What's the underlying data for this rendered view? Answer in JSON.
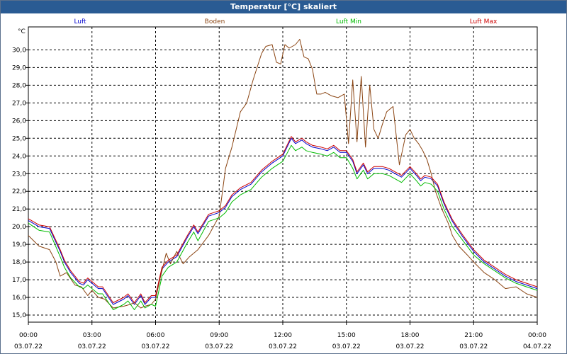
{
  "window": {
    "title": "Temperatur [°C] skaliert"
  },
  "chart_data": {
    "type": "line",
    "title": "Temperatur [°C] skaliert",
    "ylabel": "°C",
    "ylim": [
      14.6,
      31.3
    ],
    "xlim": [
      0,
      24
    ],
    "grid": true,
    "legend_position": "top",
    "y_ticks": [
      "15,0",
      "16,0",
      "17,0",
      "18,0",
      "19,0",
      "20,0",
      "21,0",
      "22,0",
      "23,0",
      "24,0",
      "25,0",
      "26,0",
      "27,0",
      "28,0",
      "29,0",
      "30,0"
    ],
    "x_ticks": [
      {
        "time": "00:00",
        "date": "03.07.22"
      },
      {
        "time": "03:00",
        "date": "03.07.22"
      },
      {
        "time": "06:00",
        "date": "03.07.22"
      },
      {
        "time": "09:00",
        "date": "03.07.22"
      },
      {
        "time": "12:00",
        "date": "03.07.22"
      },
      {
        "time": "15:00",
        "date": "03.07.22"
      },
      {
        "time": "18:00",
        "date": "03.07.22"
      },
      {
        "time": "21:00",
        "date": "03.07.22"
      },
      {
        "time": "00:00",
        "date": "04.07.22"
      }
    ],
    "series": [
      {
        "name": "Luft",
        "color": "#0000cc",
        "x": [
          0,
          0.5,
          1,
          1.5,
          1.7,
          2,
          2.4,
          2.6,
          2.8,
          3,
          3.3,
          3.5,
          4,
          4.5,
          4.7,
          5,
          5.3,
          5.5,
          5.8,
          6,
          6.3,
          6.6,
          7,
          7.5,
          7.8,
          8,
          8.5,
          9,
          9.3,
          9.6,
          10,
          10.5,
          11,
          11.3,
          11.5,
          12,
          12.4,
          12.6,
          12.9,
          13.1,
          13.4,
          13.8,
          14.1,
          14.4,
          14.7,
          15,
          15.3,
          15.5,
          15.8,
          16,
          16.3,
          16.7,
          17,
          17.3,
          17.6,
          18,
          18.3,
          18.5,
          18.7,
          19,
          19.3,
          19.6,
          20,
          20.5,
          21,
          21.5,
          22,
          22.5,
          23,
          23.5,
          24
        ],
        "y": [
          20.35,
          20.0,
          19.9,
          18.6,
          18.0,
          17.4,
          16.8,
          16.7,
          17.0,
          16.8,
          16.5,
          16.5,
          15.6,
          15.9,
          16.1,
          15.6,
          16.1,
          15.6,
          16.0,
          16.0,
          17.6,
          18.0,
          18.3,
          19.4,
          20.0,
          19.6,
          20.6,
          20.8,
          21.1,
          21.7,
          22.1,
          22.4,
          23.1,
          23.4,
          23.6,
          24.0,
          25.0,
          24.7,
          24.9,
          24.7,
          24.5,
          24.4,
          24.3,
          24.5,
          24.2,
          24.2,
          23.7,
          23.0,
          23.5,
          23.0,
          23.3,
          23.3,
          23.2,
          23.0,
          22.8,
          23.3,
          22.9,
          22.6,
          22.8,
          22.7,
          22.3,
          21.3,
          20.3,
          19.4,
          18.6,
          18.0,
          17.6,
          17.2,
          16.9,
          16.7,
          16.5
        ]
      },
      {
        "name": "Boden",
        "color": "#8b4513",
        "x": [
          0,
          0.5,
          1,
          1.3,
          1.5,
          1.8,
          2.2,
          2.5,
          2.8,
          3,
          3.3,
          3.6,
          4,
          4.5,
          4.8,
          5,
          5.3,
          5.5,
          5.8,
          6,
          6.2,
          6.5,
          6.7,
          7,
          7.3,
          7.6,
          8,
          8.5,
          9,
          9.3,
          9.6,
          10,
          10.3,
          10.6,
          11,
          11.2,
          11.5,
          11.7,
          11.9,
          12.1,
          12.3,
          12.6,
          12.8,
          13,
          13.2,
          13.4,
          13.6,
          13.8,
          14,
          14.3,
          14.6,
          14.9,
          15.1,
          15.3,
          15.5,
          15.7,
          15.9,
          16.1,
          16.3,
          16.5,
          16.7,
          16.9,
          17.2,
          17.5,
          17.8,
          18,
          18.2,
          18.4,
          18.6,
          18.8,
          19,
          19.2,
          19.5,
          19.8,
          20,
          20.3,
          20.7,
          21,
          21.5,
          22,
          22.5,
          23,
          23.5,
          24
        ],
        "y": [
          19.5,
          18.9,
          18.7,
          18.0,
          17.2,
          17.4,
          16.7,
          16.6,
          16.1,
          16.4,
          16.0,
          15.9,
          15.4,
          15.5,
          15.6,
          15.7,
          15.4,
          15.5,
          15.6,
          15.9,
          17.0,
          18.5,
          17.9,
          18.6,
          17.9,
          18.3,
          18.7,
          19.5,
          20.6,
          23.3,
          24.5,
          26.5,
          27.0,
          28.3,
          29.8,
          30.2,
          30.3,
          29.3,
          29.2,
          30.3,
          30.1,
          30.3,
          30.6,
          29.6,
          29.5,
          28.9,
          27.5,
          27.5,
          27.6,
          27.4,
          27.3,
          27.5,
          24.7,
          28.3,
          24.8,
          28.5,
          24.5,
          28.0,
          25.5,
          25.0,
          25.8,
          26.5,
          26.8,
          23.5,
          25.2,
          25.5,
          25.0,
          24.7,
          24.3,
          23.8,
          23.0,
          22.0,
          21.0,
          20.2,
          19.5,
          18.9,
          18.4,
          18.0,
          17.4,
          17.0,
          16.5,
          16.6,
          16.2,
          16.0
        ]
      },
      {
        "name": "Luft Min",
        "color": "#00bb00",
        "x": [
          0,
          0.5,
          1,
          1.5,
          1.7,
          2,
          2.4,
          2.6,
          2.8,
          3,
          3.3,
          3.5,
          4,
          4.5,
          4.7,
          5,
          5.3,
          5.5,
          5.8,
          6,
          6.3,
          6.6,
          7,
          7.5,
          7.8,
          8,
          8.5,
          9,
          9.3,
          9.6,
          10,
          10.5,
          11,
          11.3,
          11.5,
          12,
          12.4,
          12.6,
          12.9,
          13.1,
          13.4,
          13.8,
          14.1,
          14.4,
          14.7,
          15,
          15.3,
          15.5,
          15.8,
          16,
          16.3,
          16.7,
          17,
          17.3,
          17.6,
          18,
          18.3,
          18.5,
          18.7,
          19,
          19.3,
          19.6,
          20,
          20.5,
          21,
          21.5,
          22,
          22.5,
          23,
          23.5,
          24
        ],
        "y": [
          20.2,
          19.8,
          19.7,
          18.3,
          17.7,
          17.1,
          16.6,
          16.5,
          16.7,
          16.5,
          16.2,
          16.2,
          15.3,
          15.6,
          15.8,
          15.3,
          15.8,
          15.4,
          15.6,
          15.5,
          17.2,
          17.7,
          18.0,
          19.1,
          19.7,
          19.2,
          20.3,
          20.5,
          20.8,
          21.4,
          21.8,
          22.1,
          22.8,
          23.1,
          23.3,
          23.7,
          24.6,
          24.3,
          24.5,
          24.3,
          24.2,
          24.1,
          24.0,
          24.2,
          23.9,
          23.9,
          23.3,
          22.7,
          23.2,
          22.7,
          23.0,
          23.0,
          22.9,
          22.7,
          22.5,
          23.0,
          22.6,
          22.3,
          22.5,
          22.4,
          22.0,
          21.0,
          20.0,
          19.2,
          18.4,
          17.9,
          17.5,
          17.1,
          16.8,
          16.6,
          16.4
        ]
      },
      {
        "name": "Luft Max",
        "color": "#cc0000",
        "x": [
          0,
          0.5,
          1,
          1.5,
          1.7,
          2,
          2.4,
          2.6,
          2.8,
          3,
          3.3,
          3.5,
          4,
          4.5,
          4.7,
          5,
          5.3,
          5.5,
          5.8,
          6,
          6.3,
          6.6,
          7,
          7.5,
          7.8,
          8,
          8.5,
          9,
          9.3,
          9.6,
          10,
          10.5,
          11,
          11.3,
          11.5,
          12,
          12.4,
          12.6,
          12.9,
          13.1,
          13.4,
          13.8,
          14.1,
          14.4,
          14.7,
          15,
          15.3,
          15.5,
          15.8,
          16,
          16.3,
          16.7,
          17,
          17.3,
          17.6,
          18,
          18.3,
          18.5,
          18.7,
          19,
          19.3,
          19.6,
          20,
          20.5,
          21,
          21.5,
          22,
          22.5,
          23,
          23.5,
          24
        ],
        "y": [
          20.45,
          20.1,
          20.0,
          18.7,
          18.1,
          17.5,
          16.9,
          16.8,
          17.1,
          16.9,
          16.6,
          16.6,
          15.7,
          16.0,
          16.2,
          15.7,
          16.2,
          15.7,
          16.1,
          16.1,
          17.7,
          18.1,
          18.4,
          19.5,
          20.1,
          19.7,
          20.7,
          20.9,
          21.2,
          21.8,
          22.2,
          22.5,
          23.2,
          23.5,
          23.7,
          24.1,
          25.1,
          24.8,
          25.0,
          24.8,
          24.6,
          24.5,
          24.4,
          24.6,
          24.3,
          24.3,
          23.8,
          23.1,
          23.6,
          23.1,
          23.4,
          23.4,
          23.3,
          23.1,
          22.9,
          23.4,
          23.0,
          22.7,
          22.9,
          22.8,
          22.4,
          21.4,
          20.4,
          19.5,
          18.7,
          18.1,
          17.7,
          17.3,
          17.0,
          16.8,
          16.6
        ]
      }
    ]
  }
}
